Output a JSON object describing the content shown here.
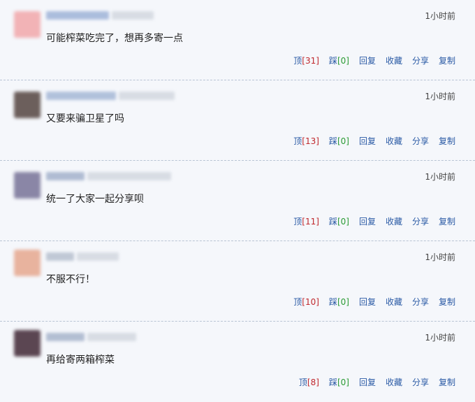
{
  "comments": [
    {
      "time": "1小时前",
      "text": "可能榨菜吃完了，想再多寄一点",
      "avatar_color": "#f2b3b6",
      "name_color": "#9fb3d8",
      "up_label": "顶",
      "up_count": "[31]",
      "down_label": "踩",
      "down_count": "[0]",
      "reply_label": "回复",
      "fav_label": "收藏",
      "share_label": "分享",
      "copy_label": "复制"
    },
    {
      "time": "1小时前",
      "text": "又要来骗卫星了吗",
      "avatar_color": "#6c5f5c",
      "name_color": "#a6b8d6",
      "up_label": "顶",
      "up_count": "[13]",
      "down_label": "踩",
      "down_count": "[0]",
      "reply_label": "回复",
      "fav_label": "收藏",
      "share_label": "分享",
      "copy_label": "复制"
    },
    {
      "time": "1小时前",
      "text": "统一了大家一起分享呗",
      "avatar_color": "#8a86a6",
      "name_color": "#a4b2cc",
      "up_label": "顶",
      "up_count": "[11]",
      "down_label": "踩",
      "down_count": "[0]",
      "reply_label": "回复",
      "fav_label": "收藏",
      "share_label": "分享",
      "copy_label": "复制"
    },
    {
      "time": "1小时前",
      "text": "不服不行！",
      "avatar_color": "#e8b39e",
      "name_color": "#b7c0cf",
      "up_label": "顶",
      "up_count": "[10]",
      "down_label": "踩",
      "down_count": "[0]",
      "reply_label": "回复",
      "fav_label": "收藏",
      "share_label": "分享",
      "copy_label": "复制"
    },
    {
      "time": "1小时前",
      "text": "再给寄两箱榨菜",
      "avatar_color": "#5b4652",
      "name_color": "#a8b5cc",
      "up_label": "顶",
      "up_count": "[8]",
      "down_label": "踩",
      "down_count": "[0]",
      "reply_label": "回复",
      "fav_label": "收藏",
      "share_label": "分享",
      "copy_label": "复制"
    }
  ]
}
